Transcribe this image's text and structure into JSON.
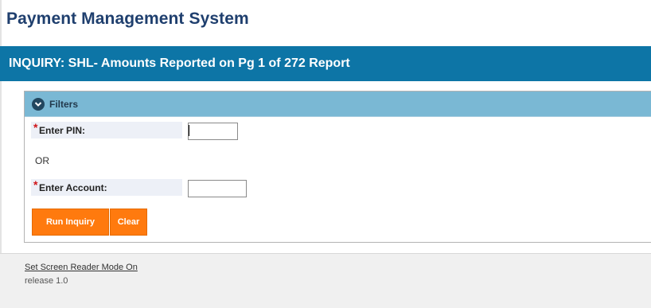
{
  "app": {
    "title": "Payment Management System"
  },
  "page": {
    "header": "INQUIRY: SHL- Amounts Reported on Pg 1 of 272 Report"
  },
  "filters": {
    "title": "Filters",
    "toggle_icon": "chevron-down-icon",
    "required_marker": "*",
    "pin": {
      "label": "Enter PIN:",
      "value": ""
    },
    "or_text": "OR",
    "account": {
      "label": "Enter Account:",
      "value": ""
    }
  },
  "buttons": {
    "run_inquiry": "Run Inquiry",
    "clear": "Clear"
  },
  "footer": {
    "screen_reader_link": "Set Screen Reader Mode On",
    "release": "release 1.0"
  },
  "colors": {
    "title": "#1f3f6e",
    "header_bar": "#0d75a6",
    "panel_header": "#7ab8d4",
    "button": "#ff7a0e",
    "required": "#d0161a"
  }
}
